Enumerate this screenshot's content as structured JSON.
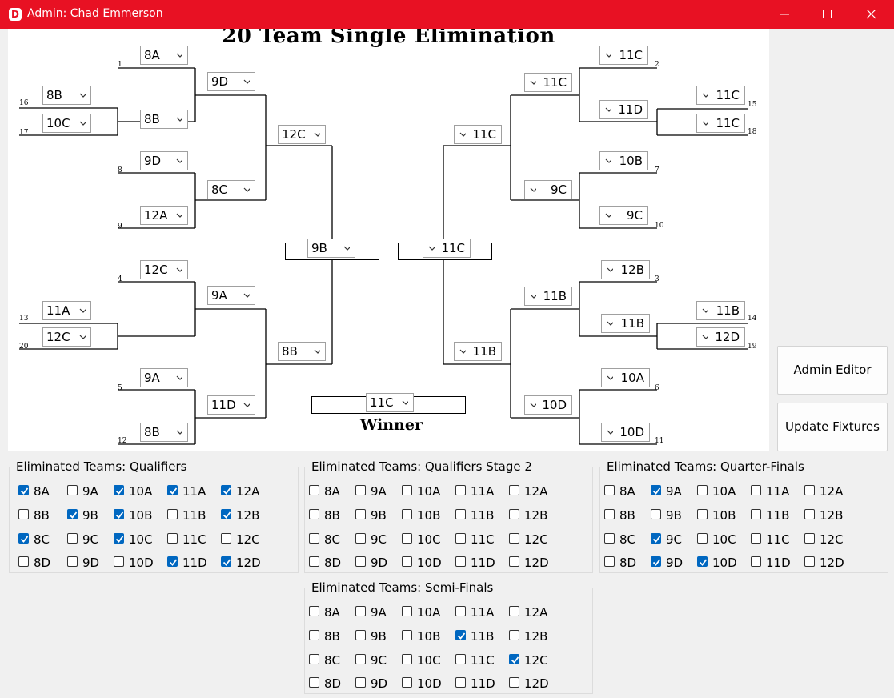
{
  "window": {
    "title": "Admin: Chad Emmerson",
    "logo_letter": "D"
  },
  "bracket": {
    "title": "20 Team Single Elimination",
    "winner_label": "Winner",
    "seeds": [
      "1",
      "16",
      "17",
      "8",
      "9",
      "4",
      "13",
      "20",
      "5",
      "12",
      "2",
      "15",
      "18",
      "7",
      "10",
      "3",
      "14",
      "19",
      "6",
      "11"
    ],
    "selections": [
      "8A",
      "8B",
      "10C",
      "8B",
      "9D",
      "9D",
      "12A",
      "8C",
      "12C",
      "11A",
      "12C",
      "9A",
      "9A",
      "11D",
      "8B",
      "12C",
      "8B",
      "9B",
      "11C",
      "11C",
      "11C",
      "11D",
      "11C",
      "10B",
      "9C",
      "9C",
      "12B",
      "11B",
      "11B",
      "11B",
      "12D",
      "10A",
      "10D",
      "10D",
      "11B",
      "11C",
      "11C",
      "11C"
    ]
  },
  "buttons": {
    "admin_editor": "Admin Editor",
    "update_fixtures": "Update Fixtures"
  },
  "groups": [
    {
      "title": "Eliminated Teams: Qualifiers",
      "items": [
        {
          "label": "8A",
          "checked": true
        },
        {
          "label": "9A",
          "checked": false
        },
        {
          "label": "10A",
          "checked": true
        },
        {
          "label": "11A",
          "checked": true
        },
        {
          "label": "12A",
          "checked": true
        },
        {
          "label": "8B",
          "checked": false
        },
        {
          "label": "9B",
          "checked": true
        },
        {
          "label": "10B",
          "checked": true
        },
        {
          "label": "11B",
          "checked": false
        },
        {
          "label": "12B",
          "checked": true
        },
        {
          "label": "8C",
          "checked": true
        },
        {
          "label": "9C",
          "checked": false
        },
        {
          "label": "10C",
          "checked": true
        },
        {
          "label": "11C",
          "checked": false
        },
        {
          "label": "12C",
          "checked": false
        },
        {
          "label": "8D",
          "checked": false
        },
        {
          "label": "9D",
          "checked": false
        },
        {
          "label": "10D",
          "checked": false
        },
        {
          "label": "11D",
          "checked": true
        },
        {
          "label": "12D",
          "checked": true
        }
      ]
    },
    {
      "title": "Eliminated Teams: Qualifiers Stage 2",
      "items": [
        {
          "label": "8A",
          "checked": false
        },
        {
          "label": "9A",
          "checked": false
        },
        {
          "label": "10A",
          "checked": false
        },
        {
          "label": "11A",
          "checked": false
        },
        {
          "label": "12A",
          "checked": false
        },
        {
          "label": "8B",
          "checked": false
        },
        {
          "label": "9B",
          "checked": false
        },
        {
          "label": "10B",
          "checked": false
        },
        {
          "label": "11B",
          "checked": false
        },
        {
          "label": "12B",
          "checked": false
        },
        {
          "label": "8C",
          "checked": false
        },
        {
          "label": "9C",
          "checked": false
        },
        {
          "label": "10C",
          "checked": false
        },
        {
          "label": "11C",
          "checked": false
        },
        {
          "label": "12C",
          "checked": false
        },
        {
          "label": "8D",
          "checked": false
        },
        {
          "label": "9D",
          "checked": false
        },
        {
          "label": "10D",
          "checked": false
        },
        {
          "label": "11D",
          "checked": false
        },
        {
          "label": "12D",
          "checked": false
        }
      ]
    },
    {
      "title": "Eliminated Teams: Quarter-Finals",
      "items": [
        {
          "label": "8A",
          "checked": false
        },
        {
          "label": "9A",
          "checked": true
        },
        {
          "label": "10A",
          "checked": false
        },
        {
          "label": "11A",
          "checked": false
        },
        {
          "label": "12A",
          "checked": false
        },
        {
          "label": "8B",
          "checked": false
        },
        {
          "label": "9B",
          "checked": false
        },
        {
          "label": "10B",
          "checked": false
        },
        {
          "label": "11B",
          "checked": false
        },
        {
          "label": "12B",
          "checked": false
        },
        {
          "label": "8C",
          "checked": false
        },
        {
          "label": "9C",
          "checked": true
        },
        {
          "label": "10C",
          "checked": false
        },
        {
          "label": "11C",
          "checked": false
        },
        {
          "label": "12C",
          "checked": false
        },
        {
          "label": "8D",
          "checked": false
        },
        {
          "label": "9D",
          "checked": true
        },
        {
          "label": "10D",
          "checked": true
        },
        {
          "label": "11D",
          "checked": false
        },
        {
          "label": "12D",
          "checked": false
        }
      ]
    },
    {
      "title": "Eliminated Teams: Semi-Finals",
      "items": [
        {
          "label": "8A",
          "checked": false
        },
        {
          "label": "9A",
          "checked": false
        },
        {
          "label": "10A",
          "checked": false
        },
        {
          "label": "11A",
          "checked": false
        },
        {
          "label": "12A",
          "checked": false
        },
        {
          "label": "8B",
          "checked": false
        },
        {
          "label": "9B",
          "checked": false
        },
        {
          "label": "10B",
          "checked": false
        },
        {
          "label": "11B",
          "checked": true
        },
        {
          "label": "12B",
          "checked": false
        },
        {
          "label": "8C",
          "checked": false
        },
        {
          "label": "9C",
          "checked": false
        },
        {
          "label": "10C",
          "checked": false
        },
        {
          "label": "11C",
          "checked": false
        },
        {
          "label": "12C",
          "checked": true
        },
        {
          "label": "8D",
          "checked": false
        },
        {
          "label": "9D",
          "checked": false
        },
        {
          "label": "10D",
          "checked": false
        },
        {
          "label": "11D",
          "checked": false
        },
        {
          "label": "12D",
          "checked": false
        }
      ]
    }
  ]
}
